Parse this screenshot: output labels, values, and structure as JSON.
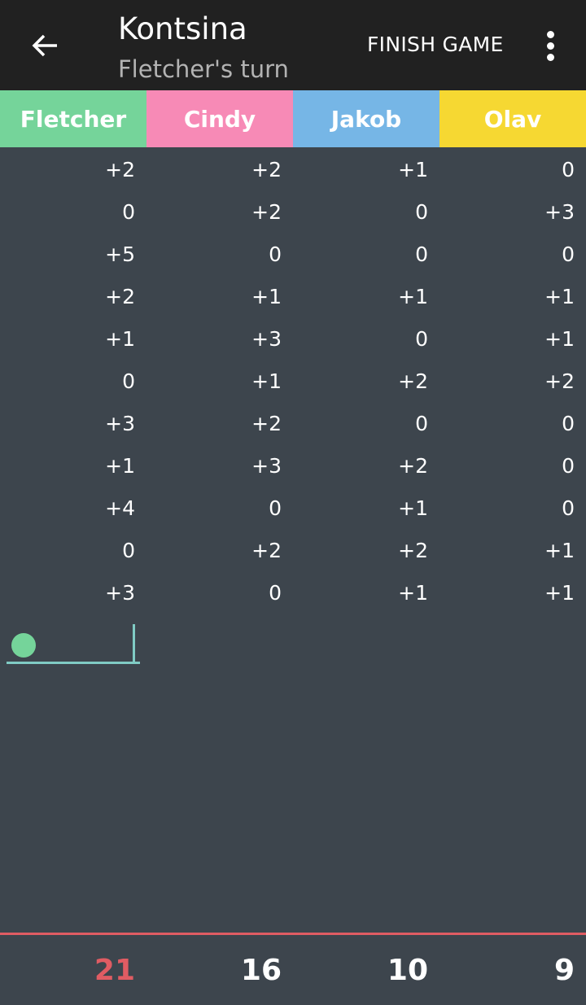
{
  "appbar": {
    "title": "Kontsina",
    "subtitle": "Fletcher's turn",
    "finish_label": "FINISH GAME",
    "back_icon": "arrow-left-icon",
    "menu_icon": "more-vertical-icon"
  },
  "players": [
    {
      "name": "Fletcher",
      "color": "#75d49a"
    },
    {
      "name": "Cindy",
      "color": "#f78ab6"
    },
    {
      "name": "Jakob",
      "color": "#76b6e6"
    },
    {
      "name": "Olav",
      "color": "#f6d832"
    }
  ],
  "rounds": [
    [
      "+2",
      "+2",
      "+1",
      "0"
    ],
    [
      "0",
      "+2",
      "0",
      "+3"
    ],
    [
      "+5",
      "0",
      "0",
      "0"
    ],
    [
      "+2",
      "+1",
      "+1",
      "+1"
    ],
    [
      "+1",
      "+3",
      "0",
      "+1"
    ],
    [
      "0",
      "+1",
      "+2",
      "+2"
    ],
    [
      "+3",
      "+2",
      "0",
      "0"
    ],
    [
      "+1",
      "+3",
      "+2",
      "0"
    ],
    [
      "+4",
      "0",
      "+1",
      "0"
    ],
    [
      "0",
      "+2",
      "+2",
      "+1"
    ],
    [
      "+3",
      "0",
      "+1",
      "+1"
    ]
  ],
  "entry": {
    "value": "",
    "active_player": "Fletcher"
  },
  "totals": [
    {
      "value": "21",
      "leader": true
    },
    {
      "value": "16",
      "leader": false
    },
    {
      "value": "10",
      "leader": false
    },
    {
      "value": "9",
      "leader": false
    }
  ],
  "colors": {
    "leader": "#e05c63",
    "accent_line": "#80cbc4"
  }
}
